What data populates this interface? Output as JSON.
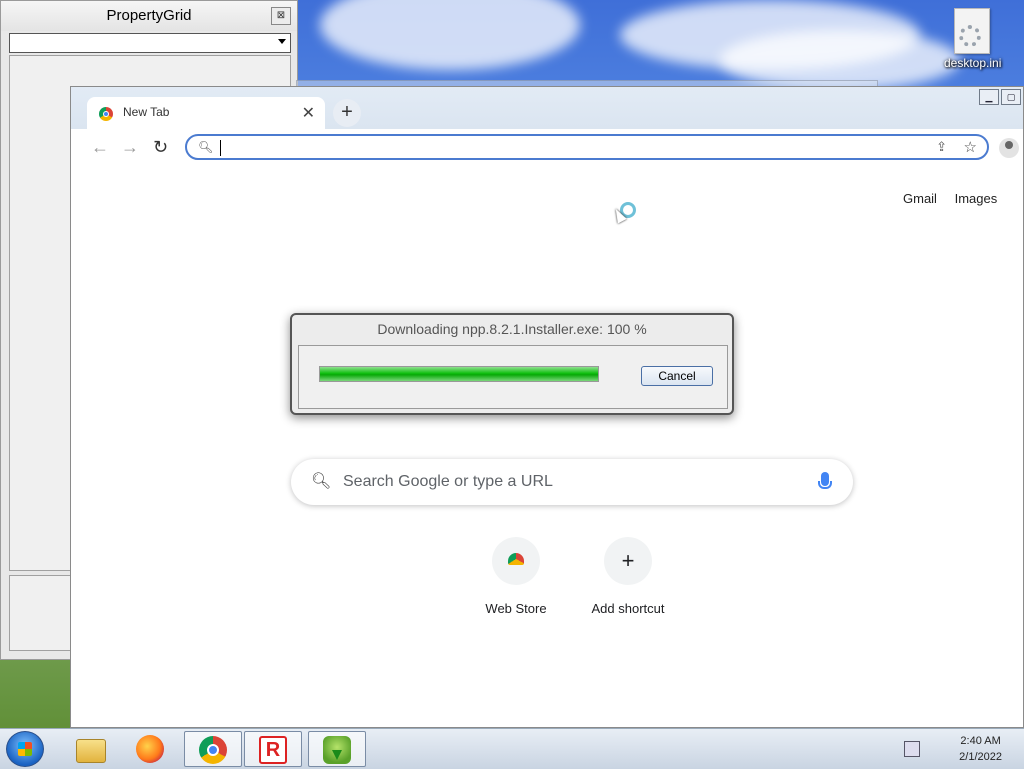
{
  "desktop": {
    "icon_label": "desktop.ini"
  },
  "property_grid": {
    "title": "PropertyGrid",
    "close_glyph": "⊠"
  },
  "browser": {
    "tab_title": "New Tab",
    "tab_close": "✕",
    "new_tab": "+",
    "back": "←",
    "forward": "→",
    "reload": "↻",
    "window_buttons": [
      "▁",
      "▢",
      "✕"
    ],
    "top_links": [
      "Gmail",
      "Images"
    ],
    "search_placeholder": "Search Google or type a URL",
    "shortcuts": [
      {
        "label": "Web Store",
        "icon": "web-store-icon"
      },
      {
        "label": "Add shortcut",
        "icon": "plus-icon",
        "glyph": "+"
      }
    ]
  },
  "download_dialog": {
    "title": "Downloading npp.8.2.1.Installer.exe: 100 %",
    "progress": 100,
    "cancel_label": "Cancel"
  },
  "taskbar": {
    "items": [
      "file-explorer-icon",
      "firefox-icon",
      "chrome-icon",
      "app-r-icon",
      "installer-icon"
    ],
    "time": "2:40 AM",
    "date": "2/1/2022"
  },
  "colors": {
    "accent": "#4b7bd0",
    "progress_green": "#10c010"
  }
}
